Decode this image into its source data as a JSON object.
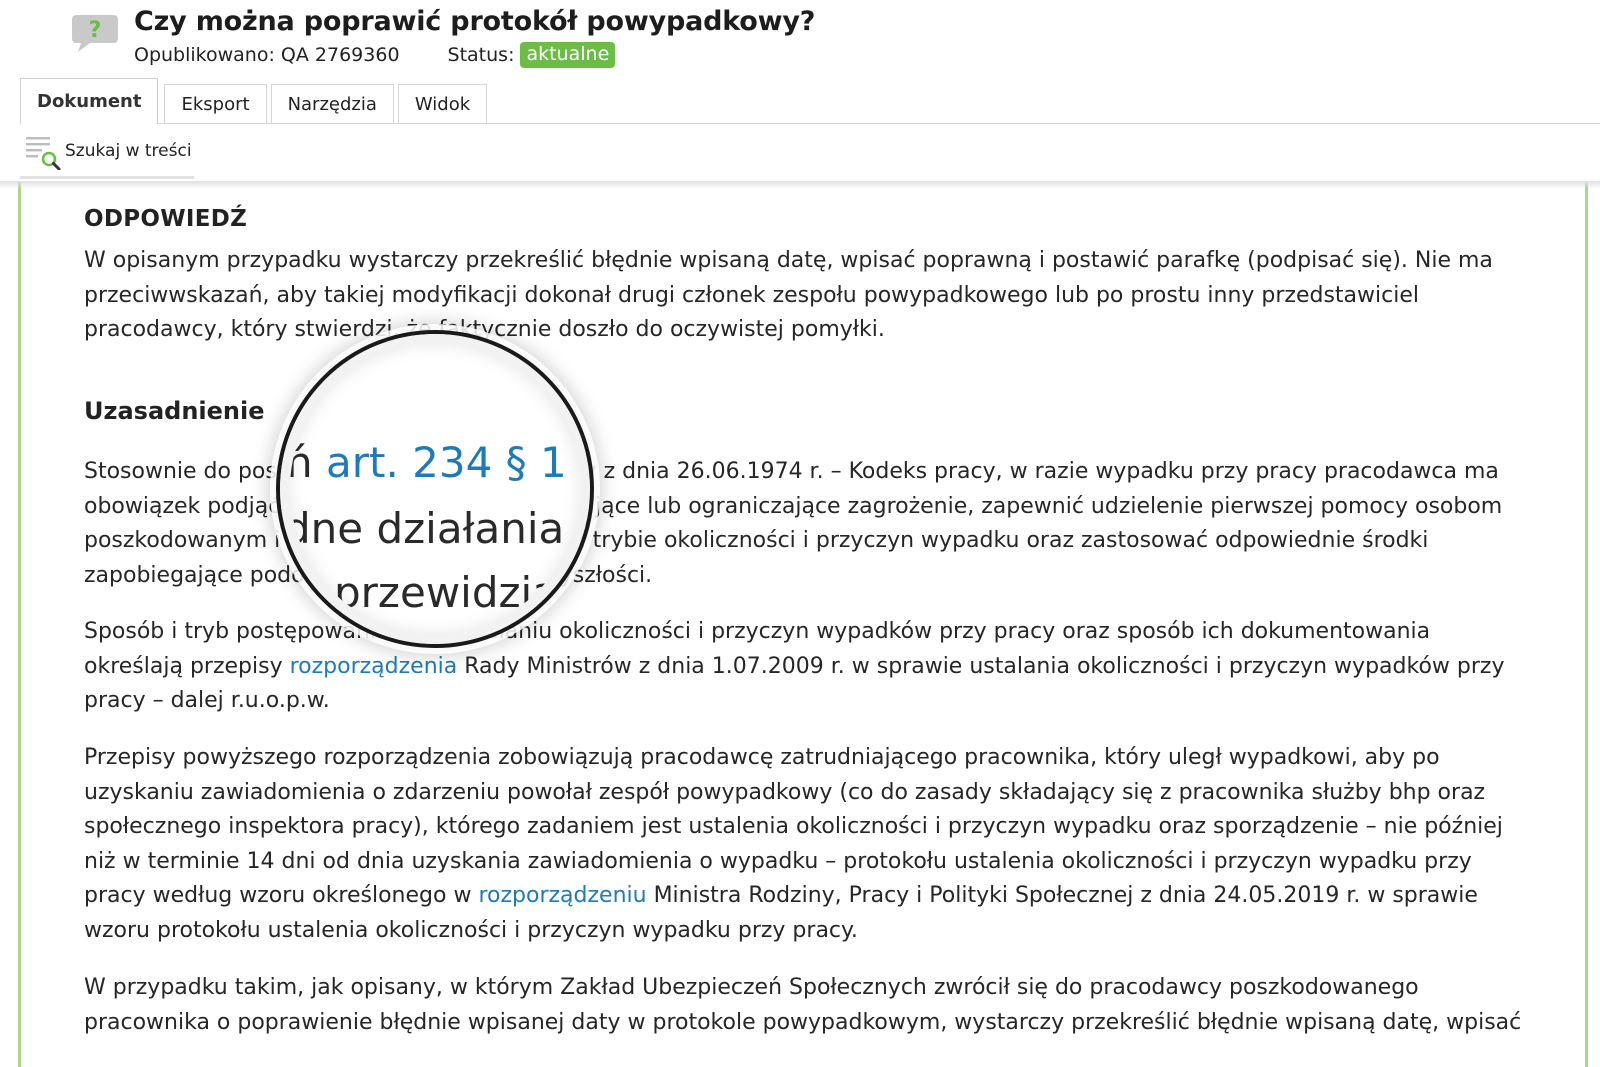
{
  "header": {
    "title": "Czy można poprawić protokół powypadkowy?",
    "published": "Opublikowano: QA 2769360",
    "status_label": "Status:",
    "status_value": "aktualne",
    "status_color": "#6cbd45",
    "icon": "question-bubble-icon"
  },
  "tabs": [
    {
      "label": "Dokument",
      "active": true
    },
    {
      "label": "Eksport",
      "active": false
    },
    {
      "label": "Narzędzia",
      "active": false
    },
    {
      "label": "Widok",
      "active": false
    }
  ],
  "toolbar": {
    "search_label": "Szukaj w treści",
    "search_icon": "search-in-text-icon"
  },
  "document": {
    "answer_heading": "ODPOWIEDŹ",
    "answer_text": "W opisanym przypadku wystarczy przekreślić błędnie wpisaną datę, wpisać poprawną i postawić parafkę (podpisać się). Nie ma przeciwwskazań, aby takiej modyfikacji dokonał drugi członek zespołu powypadkowego lub po prostu inny przedstawiciel pracodawcy, który stwierdzi, że faktycznie doszło do oczywistej pomyłki.",
    "justification_heading": "Uzasadnienie",
    "p1": "Stosownie do postanowień art. 234 § 1 ustawy z dnia 26.06.1974 r. – Kodeks pracy, w razie wypadku przy pracy pracodawca ma obowiązek podjąć niezbędne działania eliminujące lub ograniczające zagrożenie, zapewnić udzielenie pierwszej pomocy osobom poszkodowanym i ustalenie w przewidzianym trybie okoliczności i przyczyn wypadku oraz zastosować odpowiednie środki zapobiegające podobnym wypadkom w przyszłości.",
    "p2_before": "Sposób i tryb postępowania przy ustalaniu okoliczności i przyczyn wypadków przy pracy oraz sposób ich dokumentowania określają przepisy ",
    "p2_link": "rozporządzenia",
    "p2_after": " Rady Ministrów z dnia 1.07.2009 r. w sprawie ustalania okoliczności i przyczyn wypadków przy pracy – dalej r.u.o.p.w.",
    "p3_before": "Przepisy powyższego rozporządzenia zobowiązują pracodawcę zatrudniającego pracownika, który uległ wypadkowi, aby po uzyskaniu zawiadomienia o zdarzeniu powołał zespół powypadkowy (co do zasady składający się z pracownika służby bhp oraz społecznego inspektora pracy), którego zadaniem jest ustalenia okoliczności i przyczyn wypadku oraz sporządzenie – nie później niż w terminie 14 dni od dnia uzyskania zawiadomienia o wypadku – protokołu ustalenia okoliczności i przyczyn wypadku przy pracy według wzoru określonego w ",
    "p3_link": "rozporządzeniu",
    "p3_after": " Ministra Rodziny, Pracy i Polityki Społecznej z dnia 24.05.2019 r. w sprawie wzoru protokołu ustalenia okoliczności i przyczyn wypadku przy pracy.",
    "p4": "W przypadku takim, jak opisany, w którym Zakład Ubezpieczeń Społecznych zwrócił się do pracodawcy poszkodowanego pracownika o poprawienie błędnie wpisanej daty w protokole powypadkowym, wystarczy przekreślić błędnie wpisaną datę, wpisać",
    "link_color": "#1f7ab8"
  },
  "magnifier": {
    "line1_prefix": "ń ",
    "line1_link": "art. 234 § 1",
    "line1_suffix": " u",
    "line2": "dne działania e",
    "line3": "przewidzia"
  }
}
